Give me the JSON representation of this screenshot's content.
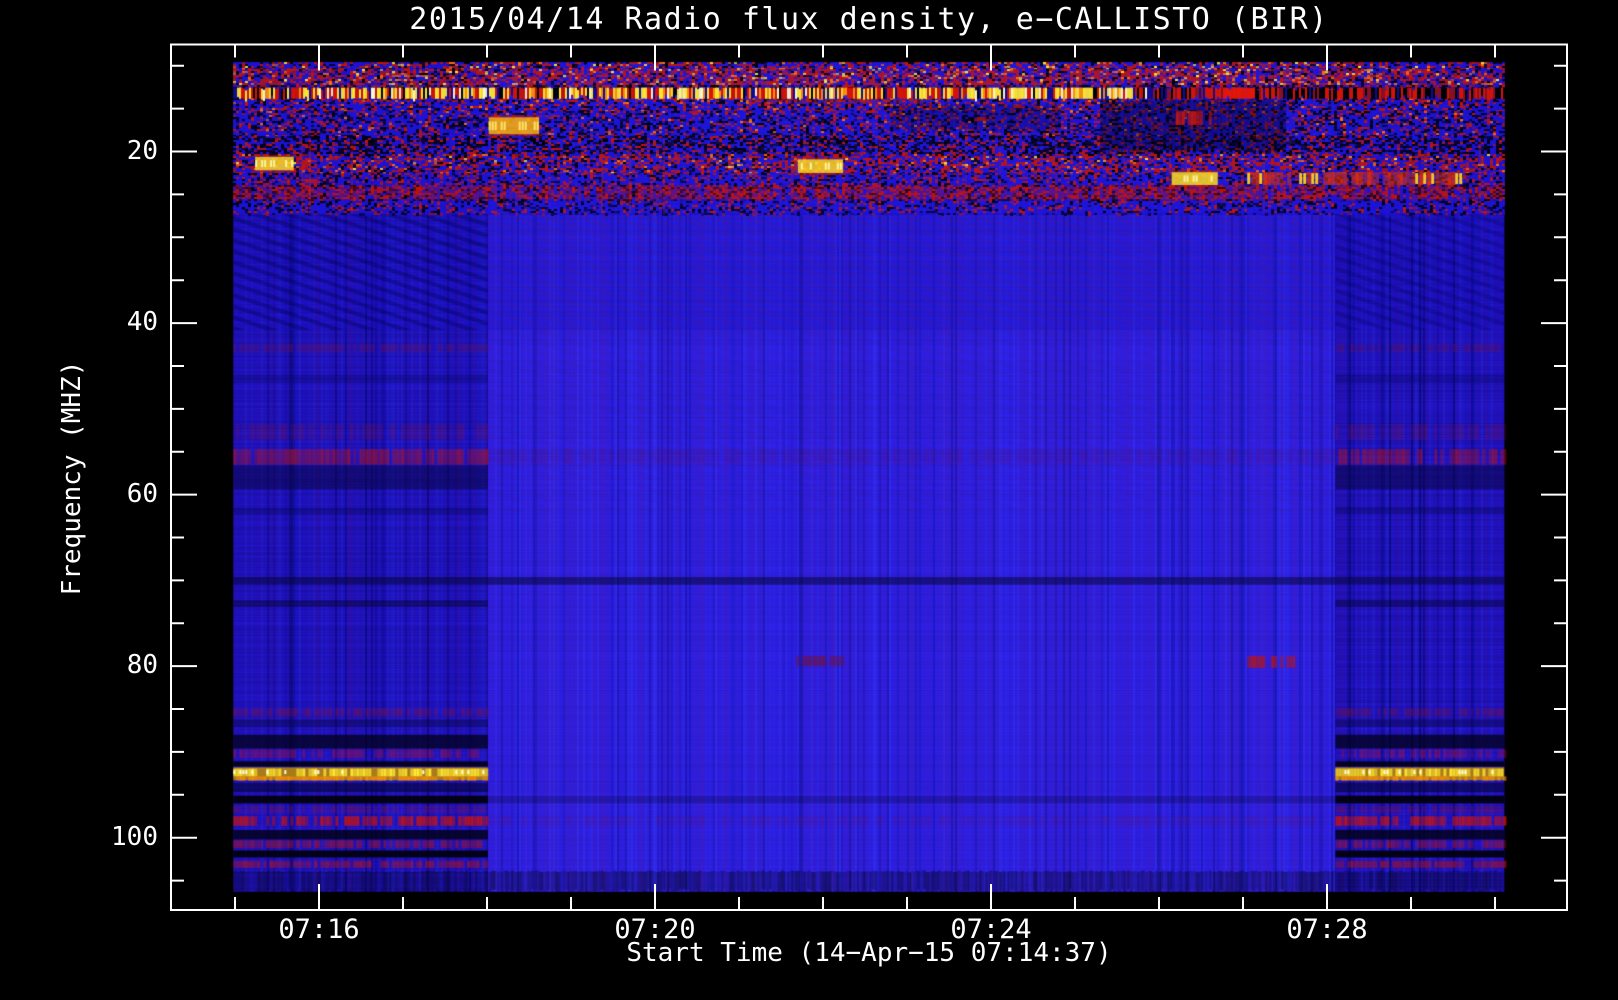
{
  "chart_data": {
    "type": "heatmap",
    "subtype": "radio-spectrogram",
    "title": "2015/04/14  Radio flux density, e−CALLISTO (BIR)",
    "xlabel": "Start Time (14−Apr−15 07:14:37)",
    "ylabel": "Frequency (MHZ)",
    "grid": false,
    "axes": {
      "t_min": 14.238,
      "t_max": 30.857,
      "f_min": 7.52,
      "f_max": 108.43,
      "t_units": "minutes after 07:00 UT",
      "f_units": "MHz"
    },
    "x_axis": {
      "major": [
        {
          "value": 16,
          "label": "07:16"
        },
        {
          "value": 20,
          "label": "07:20"
        },
        {
          "value": 24,
          "label": "07:24"
        },
        {
          "value": 28,
          "label": "07:28"
        }
      ],
      "minor": [
        15,
        17,
        18,
        19,
        21,
        22,
        23,
        25,
        26,
        27,
        29,
        30
      ]
    },
    "y_axis": {
      "major": [
        {
          "value": 20,
          "label": "20"
        },
        {
          "value": 40,
          "label": "40"
        },
        {
          "value": 60,
          "label": "60"
        },
        {
          "value": 80,
          "label": "80"
        },
        {
          "value": 100,
          "label": "100"
        }
      ],
      "minor": [
        10,
        15,
        25,
        30,
        35,
        45,
        50,
        55,
        65,
        70,
        75,
        85,
        90,
        95,
        105
      ]
    },
    "data_extent": {
      "t1": 14.98,
      "t2": 30.11,
      "f1": 9.62,
      "f2": 106.3
    },
    "segments": [
      {
        "name": "left",
        "t1": 14.98,
        "t2": 18.01,
        "base": "#1c13cd",
        "tone": "side"
      },
      {
        "name": "center",
        "t1": 18.01,
        "t2": 28.1,
        "base": "#2a21ee",
        "tone": "center"
      },
      {
        "name": "right",
        "t1": 28.1,
        "t2": 30.11,
        "base": "#1c13cd",
        "tone": "side"
      }
    ],
    "top_zone": {
      "f1": 9.62,
      "f2": 27.2,
      "profile": [
        {
          "f1": 9.62,
          "f2": 10.4,
          "w": {
            "red": 0.3,
            "black": 0.18,
            "blue": 0.42,
            "orange": 0.06,
            "yellow": 0.04
          }
        },
        {
          "f1": 10.4,
          "f2": 12.3,
          "w": {
            "red": 0.42,
            "black": 0.14,
            "blue": 0.32,
            "orange": 0.09,
            "yellow": 0.03
          }
        },
        {
          "f1": 12.3,
          "f2": 12.55,
          "w": {
            "red": 0.2,
            "black": 0.4,
            "blue": 0.4
          }
        },
        {
          "f1": 13.85,
          "f2": 15.3,
          "w": {
            "red": 0.24,
            "black": 0.2,
            "blue": 0.52,
            "orange": 0.04
          }
        },
        {
          "f1": 15.3,
          "f2": 18.3,
          "w": {
            "red": 0.17,
            "black": 0.25,
            "blue": 0.55,
            "orange": 0.03
          }
        },
        {
          "f1": 18.3,
          "f2": 20.3,
          "w": {
            "red": 0.18,
            "black": 0.44,
            "blue": 0.38
          }
        },
        {
          "f1": 20.3,
          "f2": 22.6,
          "w": {
            "red": 0.36,
            "black": 0.17,
            "blue": 0.41,
            "orange": 0.05,
            "yellow": 0.01
          }
        },
        {
          "f1": 22.6,
          "f2": 24.0,
          "w": {
            "red": 0.2,
            "black": 0.22,
            "blue": 0.58
          }
        },
        {
          "f1": 24.0,
          "f2": 25.6,
          "w": {
            "red": 0.36,
            "black": 0.2,
            "blue": 0.44
          }
        },
        {
          "f1": 25.6,
          "f2": 27.2,
          "w": {
            "red": 0.14,
            "black": 0.22,
            "blue": 0.64
          }
        }
      ]
    },
    "striped_line": {
      "f1": 12.55,
      "f2": 13.85,
      "yellow_until": 25.9,
      "palette_yellow": [
        "#ffe832",
        "#fffbd0",
        "#ff9008",
        "#d81400",
        "#c41208",
        "#100a90",
        "#000000"
      ],
      "weights_yellow": [
        0.28,
        0.1,
        0.12,
        0.2,
        0.1,
        0.12,
        0.08
      ],
      "palette_red": [
        "#d81400",
        "#8c1020",
        "#000000",
        "#100a90"
      ],
      "weights_red": [
        0.33,
        0.2,
        0.35,
        0.12
      ],
      "solid_red": {
        "t1": 26.75,
        "t2": 27.12,
        "color": "#e81600"
      }
    },
    "vert_streaks": {
      "prob": 0.035,
      "color": "#d02008",
      "alpha": 0.28,
      "f1": 18.5,
      "f2": 27.2
    },
    "bands": [
      {
        "f1": 27.2,
        "f2": 40.8,
        "scope": "all",
        "style": "solid",
        "color": "#150dbb",
        "alpha": 0.25
      },
      {
        "f1": 42.4,
        "f2": 43.4,
        "scope": "sides",
        "style": "dash",
        "color": "#8c1230",
        "alpha": 0.3
      },
      {
        "f1": 46.0,
        "f2": 47.0,
        "scope": "sides",
        "style": "solid",
        "color": "#0a0660",
        "alpha": 0.3
      },
      {
        "f1": 51.8,
        "f2": 53.6,
        "scope": "sides",
        "style": "dash",
        "color": "#8c1230",
        "alpha": 0.3
      },
      {
        "f1": 54.7,
        "f2": 56.5,
        "scope": "sides",
        "style": "dash",
        "color": "#c41408",
        "alpha": 0.55
      },
      {
        "f1": 54.7,
        "f2": 56.5,
        "scope": "center",
        "style": "dash",
        "color": "#7a1040",
        "alpha": 0.16
      },
      {
        "f1": 56.6,
        "f2": 59.4,
        "scope": "sides",
        "style": "solid",
        "color": "#05043a",
        "alpha": 0.5
      },
      {
        "f1": 61.5,
        "f2": 62.3,
        "scope": "sides",
        "style": "solid",
        "color": "#070550",
        "alpha": 0.35
      },
      {
        "f1": 69.6,
        "f2": 70.5,
        "scope": "all",
        "style": "solid",
        "color": "#04032c",
        "alpha": 0.5
      },
      {
        "f1": 72.3,
        "f2": 73.1,
        "scope": "sides",
        "style": "solid",
        "color": "#04032c",
        "alpha": 0.45
      },
      {
        "f1": 84.9,
        "f2": 85.9,
        "scope": "sides",
        "style": "dash",
        "color": "#8c1228",
        "alpha": 0.42
      },
      {
        "f1": 86.2,
        "f2": 87.1,
        "scope": "sides",
        "style": "solid",
        "color": "#05043a",
        "alpha": 0.4
      },
      {
        "f1": 88.0,
        "f2": 89.6,
        "scope": "sides",
        "style": "solid",
        "color": "#020218",
        "alpha": 0.75
      },
      {
        "f1": 89.7,
        "f2": 90.7,
        "scope": "sides",
        "style": "dash",
        "color": "#aa1238",
        "alpha": 0.5
      },
      {
        "f1": 91.1,
        "f2": 91.7,
        "scope": "sides",
        "style": "solid",
        "color": "#000008",
        "alpha": 0.85
      },
      {
        "f1": 91.8,
        "f2": 93.3,
        "scope": "sides",
        "style": "solid",
        "color": "#b8860a",
        "alpha": 0.9
      },
      {
        "f1": 91.95,
        "f2": 92.85,
        "scope": "sides",
        "style": "bright-dash",
        "color": "#ffe832",
        "alpha": 1.0
      },
      {
        "f1": 92.85,
        "f2": 93.35,
        "scope": "sides",
        "style": "dash",
        "color": "#ff9008",
        "alpha": 0.85
      },
      {
        "f1": 93.6,
        "f2": 94.7,
        "scope": "sides",
        "style": "solid",
        "color": "#030330",
        "alpha": 0.6
      },
      {
        "f1": 95.1,
        "f2": 96.0,
        "scope": "sides",
        "style": "solid",
        "color": "#000006",
        "alpha": 0.9
      },
      {
        "f1": 95.1,
        "f2": 96.0,
        "scope": "center",
        "style": "solid",
        "color": "#000010",
        "alpha": 0.22
      },
      {
        "f1": 96.3,
        "f2": 97.1,
        "scope": "sides",
        "style": "dash",
        "color": "#8c1228",
        "alpha": 0.4
      },
      {
        "f1": 97.5,
        "f2": 98.6,
        "scope": "sides",
        "style": "dash",
        "color": "#d81400",
        "alpha": 0.8
      },
      {
        "f1": 97.5,
        "f2": 98.6,
        "scope": "center",
        "style": "dash",
        "color": "#8c1030",
        "alpha": 0.14
      },
      {
        "f1": 99.1,
        "f2": 100.2,
        "scope": "sides",
        "style": "solid",
        "color": "#010112",
        "alpha": 0.8
      },
      {
        "f1": 100.3,
        "f2": 101.2,
        "scope": "sides",
        "style": "dash",
        "color": "#c01408",
        "alpha": 0.55
      },
      {
        "f1": 101.5,
        "f2": 102.3,
        "scope": "sides",
        "style": "solid",
        "color": "#000006",
        "alpha": 0.9
      },
      {
        "f1": 102.7,
        "f2": 103.5,
        "scope": "sides",
        "style": "dash",
        "color": "#c41408",
        "alpha": 0.6
      },
      {
        "f1": 103.8,
        "f2": 106.3,
        "scope": "all",
        "style": "noisedark",
        "color": "#050518",
        "alpha": 0.55
      },
      {
        "f1": 24.0,
        "f2": 25.6,
        "scope": "all",
        "style": "dash",
        "color": "#c41200",
        "alpha": 0.4
      }
    ],
    "ripple": {
      "f1": 27.3,
      "f2": 40.8,
      "spacing": 11,
      "slope": 0.33,
      "width": 4,
      "zones": [
        {
          "scope": "left",
          "color": "#000040",
          "alpha": 0.32
        },
        {
          "scope": "center",
          "color": "#601a60",
          "alpha": 0.1
        },
        {
          "scope": "right",
          "color": "#000040",
          "alpha": 0.22
        }
      ],
      "soft": {
        "scope": "center",
        "f1": 40.8,
        "f2": 62.0,
        "color": "#601a60",
        "alpha": 0.05
      }
    },
    "features": [
      {
        "t1": 25.3,
        "t2": 27.5,
        "f1": 14.0,
        "f2": 20.0,
        "color": "#000014",
        "alpha": 0.45,
        "style": "patch"
      },
      {
        "t1": 22.8,
        "t2": 24.8,
        "f1": 14.5,
        "f2": 17.5,
        "color": "#000014",
        "alpha": 0.28,
        "style": "patch"
      },
      {
        "t1": 21.1,
        "t2": 23.2,
        "f1": 13.9,
        "f2": 14.4,
        "color": "#c02010",
        "alpha": 0.5,
        "style": "dash"
      },
      {
        "t1": 15.24,
        "t2": 15.7,
        "f1": 20.6,
        "f2": 22.2,
        "color": "#ffd820",
        "core": "#fff8a8",
        "alpha": 1.0,
        "style": "blob"
      },
      {
        "t1": 18.02,
        "t2": 18.62,
        "f1": 16.0,
        "f2": 18.0,
        "color": "#ffb10a",
        "core": "#ffec70",
        "alpha": 1.0,
        "style": "blob"
      },
      {
        "t1": 21.7,
        "t2": 22.24,
        "f1": 20.9,
        "f2": 22.5,
        "color": "#ffd820",
        "core": "#fff8a8",
        "alpha": 1.0,
        "style": "blob"
      },
      {
        "t1": 26.15,
        "t2": 26.7,
        "f1": 22.4,
        "f2": 23.9,
        "color": "#ffe020",
        "core": "#fff8a8",
        "alpha": 1.0,
        "style": "blob"
      },
      {
        "t1": 27.05,
        "t2": 29.58,
        "f1": 22.4,
        "f2": 23.9,
        "color": "#e03008",
        "core": "#ffd020",
        "alpha": 0.9,
        "style": "streak"
      },
      {
        "t1": 26.2,
        "t2": 26.62,
        "f1": 15.3,
        "f2": 16.9,
        "color": "#d01808",
        "alpha": 0.85,
        "style": "dash"
      },
      {
        "t1": 21.68,
        "t2": 22.25,
        "f1": 78.8,
        "f2": 80.0,
        "color": "#7a1022",
        "alpha": 0.55,
        "style": "dash"
      },
      {
        "t1": 27.05,
        "t2": 27.6,
        "f1": 78.8,
        "f2": 80.2,
        "color": "#c01408",
        "alpha": 0.8,
        "style": "dash"
      }
    ],
    "palette": {
      "background": "#000000",
      "frame": "#ffffff",
      "text": "#ffffff",
      "speckle_red": "#c41408",
      "speckle_black": "#000006",
      "speckle_blue": "#1c13d8",
      "speckle_orange": "#ff7008",
      "speckle_yellow": "#ffe832",
      "hot_white": "#fffde0"
    }
  }
}
